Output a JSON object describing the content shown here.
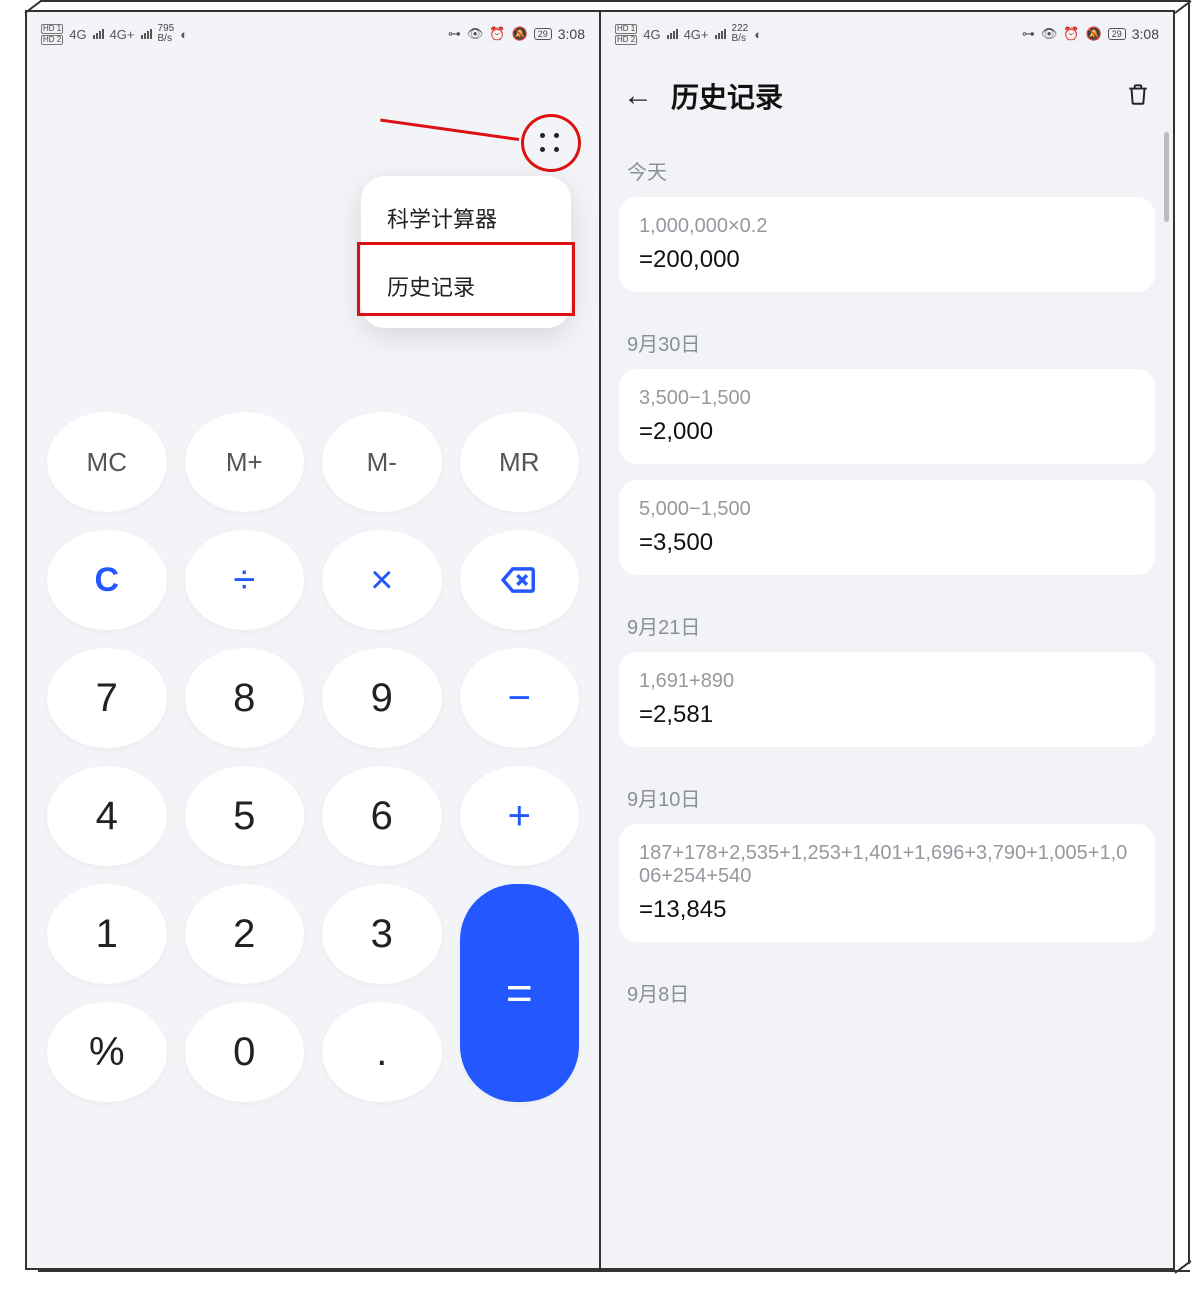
{
  "statusLeft": {
    "hd1": "HD 1",
    "hd2": "HD 2",
    "sig1": "4G",
    "sig2": "4G+",
    "bs_left": "795",
    "bs_right": "222",
    "bs_unit": "B/s"
  },
  "statusRight": {
    "batt": "29",
    "time": "3:08"
  },
  "menu": {
    "item1": "科学计算器",
    "item2": "历史记录"
  },
  "keys": {
    "mc": "MC",
    "mp": "M+",
    "mm": "M-",
    "mr": "MR",
    "c": "C",
    "div": "÷",
    "mul": "×",
    "k7": "7",
    "k8": "8",
    "k9": "9",
    "minus": "−",
    "k4": "4",
    "k5": "5",
    "k6": "6",
    "plus": "+",
    "k1": "1",
    "k2": "2",
    "k3": "3",
    "eq": "=",
    "pct": "%",
    "k0": "0",
    "dot": "."
  },
  "history": {
    "title": "历史记录",
    "groups": [
      {
        "label": "今天",
        "items": [
          {
            "expr": "1,000,000×0.2",
            "res": "=200,000"
          }
        ]
      },
      {
        "label": "9月30日",
        "items": [
          {
            "expr": "3,500−1,500",
            "res": "=2,000"
          },
          {
            "expr": "5,000−1,500",
            "res": "=3,500"
          }
        ]
      },
      {
        "label": "9月21日",
        "items": [
          {
            "expr": "1,691+890",
            "res": "=2,581"
          }
        ]
      },
      {
        "label": "9月10日",
        "items": [
          {
            "expr": "187+178+2,535+1,253+1,401+1,696+3,790+1,005+1,006+254+540",
            "res": "=13,845"
          }
        ]
      },
      {
        "label": "9月8日",
        "items": []
      }
    ]
  }
}
